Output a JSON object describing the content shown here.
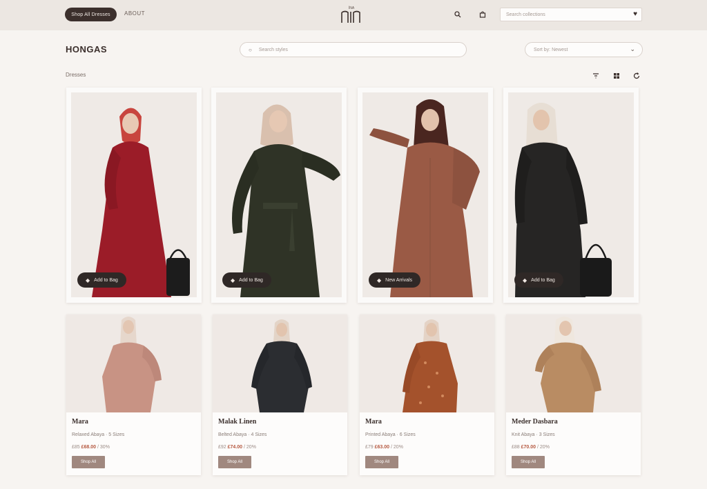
{
  "header": {
    "primary_button": "Shop All Dresses",
    "secondary_link": "ABOUT",
    "logo_label": "ÍNA",
    "search_placeholder": "Search collections"
  },
  "toolbar": {
    "title": "HONGAS",
    "search_placeholder": "Search styles",
    "sort_placeholder": "Sort by: Newest",
    "results_label": "Dresses"
  },
  "featured": [
    {
      "tag": "Add to Bag",
      "color": "#9b1c28",
      "scarf": "#c8453e"
    },
    {
      "tag": "Add to Bag",
      "color": "#2f3326",
      "scarf": "#d9c0ae"
    },
    {
      "tag": "New Arrivals",
      "color": "#9a5a45",
      "scarf": "#4a2620"
    },
    {
      "tag": "Add to Bag",
      "color": "#262524",
      "scarf": "#e7ded4"
    }
  ],
  "products": [
    {
      "name": "Mara",
      "meta": "Relaxed Abaya · 5 Sizes",
      "price_old": "£85",
      "price_new": "£68.00",
      "suffix": "/ 30%",
      "button": "Shop All",
      "color": "#c89384",
      "scarf": "#e6d7cc"
    },
    {
      "name": "Malak Linen",
      "meta": "Belted Abaya · 4 Sizes",
      "price_old": "£92",
      "price_new": "£74.00",
      "suffix": "/ 20%",
      "button": "Shop All",
      "color": "#2b2d31",
      "scarf": "#e3d4c7"
    },
    {
      "name": "Mara",
      "meta": "Printed Abaya · 6 Sizes",
      "price_old": "£79",
      "price_new": "£63.00",
      "suffix": "/ 20%",
      "button": "Shop All",
      "color": "#a4522c",
      "scarf": "#e4d3c6"
    },
    {
      "name": "Meder Dasbara",
      "meta": "Knit Abaya · 3 Sizes",
      "price_old": "£88",
      "price_new": "£70.00",
      "suffix": "/ 20%",
      "button": "Shop All",
      "color": "#b98c63",
      "scarf": "#efe7de"
    }
  ]
}
